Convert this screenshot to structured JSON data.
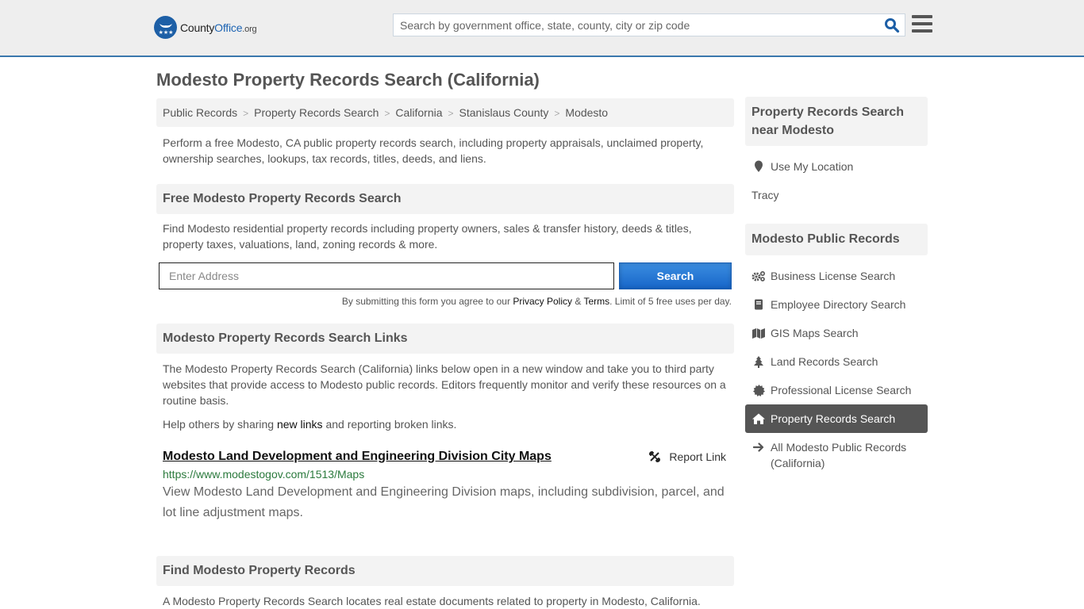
{
  "header": {
    "logo": {
      "brand_part1": "County",
      "brand_part2": "Office",
      "brand_tld": ".org"
    },
    "search": {
      "placeholder": "Search by government office, state, county, city or zip code",
      "value": ""
    },
    "icons": {
      "search": "search-icon",
      "menu": "hamburger-menu-icon"
    }
  },
  "page_title": "Modesto Property Records Search (California)",
  "breadcrumb": [
    "Public Records",
    "Property Records Search",
    "California",
    "Stanislaus County",
    "Modesto"
  ],
  "intro": "Perform a free Modesto, CA public property records search, including property appraisals, unclaimed property, ownership searches, lookups, tax records, titles, deeds, and liens.",
  "free_search": {
    "heading": "Free Modesto Property Records Search",
    "description": "Find Modesto residential property records including property owners, sales & transfer history, deeds & titles, property taxes, valuations, land, zoning records & more.",
    "address_placeholder": "Enter Address",
    "address_value": "",
    "button_label": "Search",
    "disclaimer_prefix": "By submitting this form you agree to our ",
    "privacy_label": "Privacy Policy",
    "amp": " & ",
    "terms_label": "Terms",
    "disclaimer_suffix": ". Limit of 5 free uses per day."
  },
  "links_section": {
    "heading": "Modesto Property Records Search Links",
    "description": "The Modesto Property Records Search (California) links below open in a new window and take you to third party websites that provide access to Modesto public records. Editors frequently monitor and verify these resources on a routine basis.",
    "help_prefix": "Help others by sharing ",
    "help_link": "new links",
    "help_suffix": " and reporting broken links.",
    "items": [
      {
        "title": "Modesto Land Development and Engineering Division City Maps",
        "report_label": "Report Link",
        "url": "https://www.modestogov.com/1513/Maps",
        "description": "View Modesto Land Development and Engineering Division maps, including subdivision, parcel, and lot line adjustment maps."
      }
    ]
  },
  "find_section": {
    "heading": "Find Modesto Property Records",
    "description": "A Modesto Property Records Search locates real estate documents related to property in Modesto, California."
  },
  "sidebar": {
    "nearby": {
      "heading": "Property Records Search near Modesto",
      "use_location": "Use My Location",
      "places": [
        "Tracy"
      ]
    },
    "public_records": {
      "heading": "Modesto Public Records",
      "items": [
        {
          "label": "Business License Search",
          "icon": "gears-icon",
          "active": false
        },
        {
          "label": "Employee Directory Search",
          "icon": "book-icon",
          "active": false
        },
        {
          "label": "GIS Maps Search",
          "icon": "map-icon",
          "active": false
        },
        {
          "label": "Land Records Search",
          "icon": "tree-icon",
          "active": false
        },
        {
          "label": "Professional License Search",
          "icon": "certificate-icon",
          "active": false
        },
        {
          "label": "Property Records Search",
          "icon": "home-icon",
          "active": true
        }
      ],
      "all_link": "All Modesto Public Records (California)"
    }
  },
  "colors": {
    "accent_blue": "#1d64b3",
    "header_bg": "#eeeeee",
    "header_border": "#3a78ad",
    "url_green": "#2b7a3d",
    "active_item_bg": "#555555"
  }
}
